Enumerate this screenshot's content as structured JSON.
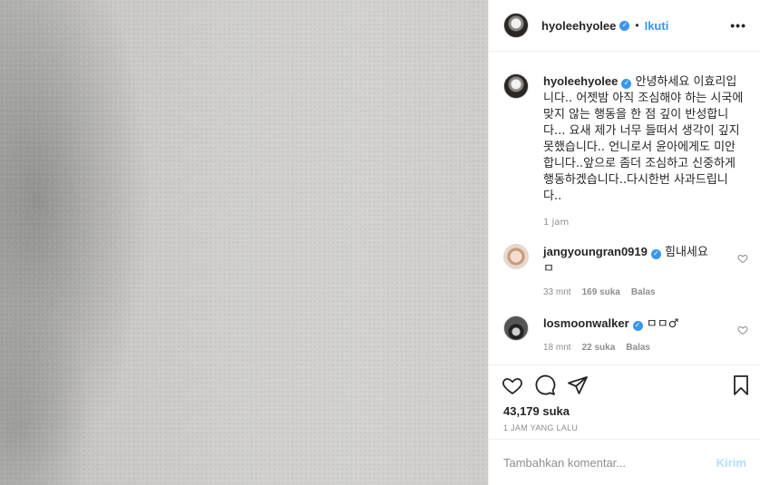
{
  "post": {
    "username": "hyoleehyolee",
    "follow_label": "Ikuti",
    "separator": "•",
    "more_label": "•••"
  },
  "caption": {
    "username": "hyoleehyolee",
    "text": "안녕하세요 이효리입니다.. 어젯밤 아직 조심해야 하는 시국에 맞지 않는 행동을 한 점 깊이 반성합니다... 요새 제가 너무 들떠서 생각이 깊지 못했습니다.. 언니로서 윤아에게도 미안합니다..앞으로 좀더 조심하고 신중하게 행동하겠습니다..다시한번 사과드립니다..",
    "time": "1 jam"
  },
  "comments": [
    {
      "username": "jangyoungran0919",
      "text": "힘내세요 ㅁ",
      "time": "33 mnt",
      "likes": "169 suka",
      "reply_label": "Balas"
    },
    {
      "username": "losmoonwalker",
      "text": "ㅁㅁ♂",
      "time": "18 mnt",
      "likes": "22 suka",
      "reply_label": "Balas"
    }
  ],
  "actions": {
    "likes_count": "43,179 suka",
    "posted_time": "1 JAM YANG LALU"
  },
  "add_comment": {
    "placeholder": "Tambahkan komentar...",
    "post_label": "Kirim"
  },
  "colors": {
    "link_blue": "#3897f0",
    "verified_blue": "#3897f0",
    "muted_gray": "#8e8e8e",
    "post_disabled": "#b2dffc"
  },
  "icons": [
    "verified-badge-icon",
    "more-icon",
    "heart-icon",
    "comment-icon",
    "share-icon",
    "bookmark-icon",
    "small-heart-icon"
  ]
}
